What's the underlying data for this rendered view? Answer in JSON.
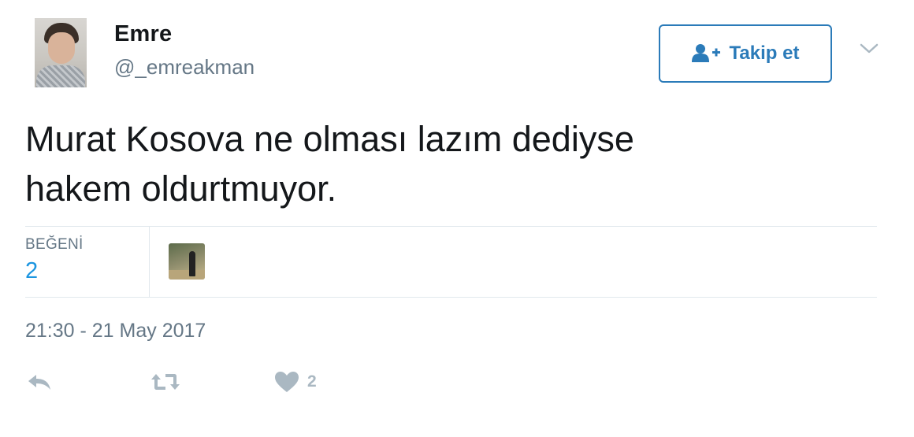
{
  "user": {
    "name": "Emre",
    "handle": "@_emreakman"
  },
  "follow": {
    "label": "Takip et"
  },
  "tweet": {
    "text_line1": "Murat Kosova ne olması lazım dediyse",
    "text_line2": "hakem oldurtmuyor."
  },
  "stats": {
    "likes_label": "BEĞENİ",
    "likes_count": "2"
  },
  "timestamp": "21:30 - 21 May 2017",
  "actions": {
    "reply_icon": "reply-icon",
    "retweet_icon": "retweet-icon",
    "like_icon": "heart-icon",
    "like_count": "2"
  },
  "colors": {
    "accent": "#1b95e0",
    "follow_border": "#2b7bb9",
    "muted": "#657786",
    "icon": "#aab8c2",
    "divider": "#e1e8ed"
  }
}
